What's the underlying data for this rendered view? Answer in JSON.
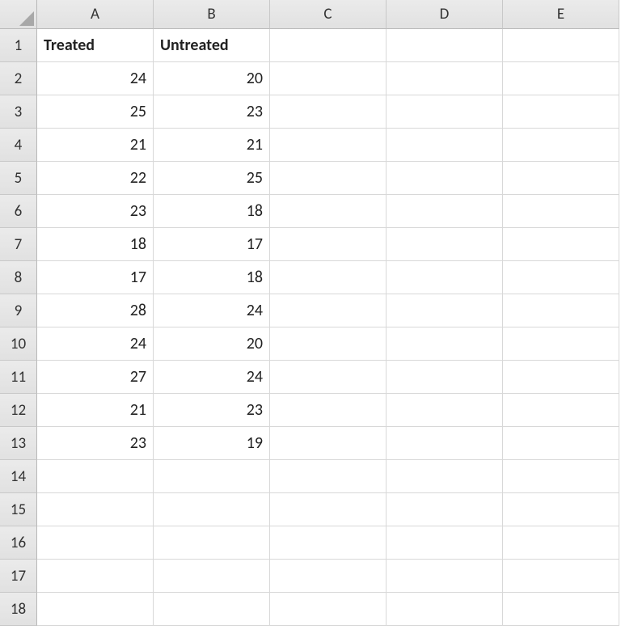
{
  "columns": [
    "A",
    "B",
    "C",
    "D",
    "E"
  ],
  "rowCount": 18,
  "headers": {
    "A1": "Treated",
    "B1": "Untreated"
  },
  "data": {
    "A": [
      "24",
      "25",
      "21",
      "22",
      "23",
      "18",
      "17",
      "28",
      "24",
      "27",
      "21",
      "23"
    ],
    "B": [
      "20",
      "23",
      "21",
      "25",
      "18",
      "17",
      "18",
      "24",
      "20",
      "24",
      "23",
      "19"
    ]
  },
  "chart_data": {
    "type": "table",
    "title": "",
    "series": [
      {
        "name": "Treated",
        "values": [
          24,
          25,
          21,
          22,
          23,
          18,
          17,
          28,
          24,
          27,
          21,
          23
        ]
      },
      {
        "name": "Untreated",
        "values": [
          20,
          23,
          21,
          25,
          18,
          17,
          18,
          24,
          20,
          24,
          23,
          19
        ]
      }
    ]
  }
}
